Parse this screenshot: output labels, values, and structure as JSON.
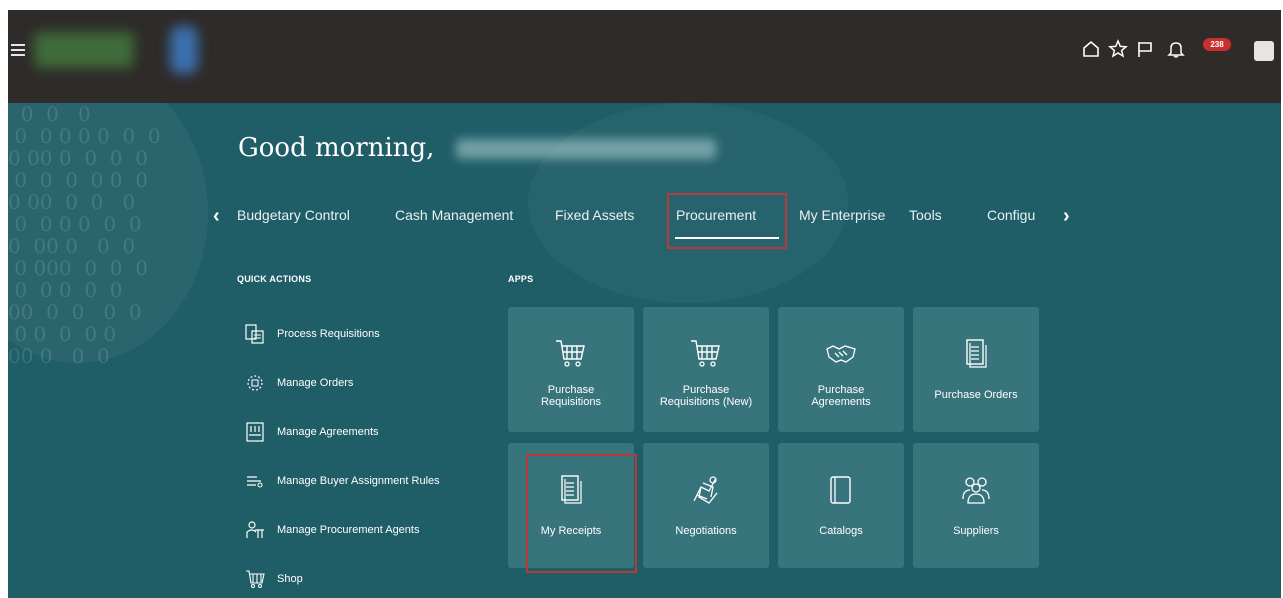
{
  "topbar": {
    "notification_count": "238",
    "icons": [
      "home-icon",
      "favorites-icon",
      "watchlist-icon",
      "notifications-icon"
    ]
  },
  "hero": {
    "greeting": "Good morning,"
  },
  "tabs": {
    "items": [
      "Budgetary Control",
      "Cash Management",
      "Fixed Assets",
      "Procurement",
      "My Enterprise",
      "Tools",
      "Configu"
    ],
    "selected": "Procurement"
  },
  "quick_actions": {
    "title": "QUICK ACTIONS",
    "items": [
      "Process Requisitions",
      "Manage Orders",
      "Manage Agreements",
      "Manage Buyer Assignment Rules",
      "Manage Procurement Agents",
      "Shop"
    ]
  },
  "apps": {
    "title": "APPS",
    "tiles": [
      {
        "line1": "Purchase",
        "line2": "Requisitions",
        "icon": "cart-icon"
      },
      {
        "line1": "Purchase",
        "line2": "Requisitions (New)",
        "icon": "cart-icon"
      },
      {
        "line1": "Purchase",
        "line2": "Agreements",
        "icon": "handshake-icon"
      },
      {
        "label": "Purchase Orders",
        "icon": "document-icon"
      },
      {
        "label": "My Receipts",
        "icon": "receipt-icon"
      },
      {
        "label": "Negotiations",
        "icon": "negotiation-icon"
      },
      {
        "label": "Catalogs",
        "icon": "catalog-icon"
      },
      {
        "label": "Suppliers",
        "icon": "suppliers-icon"
      }
    ]
  }
}
